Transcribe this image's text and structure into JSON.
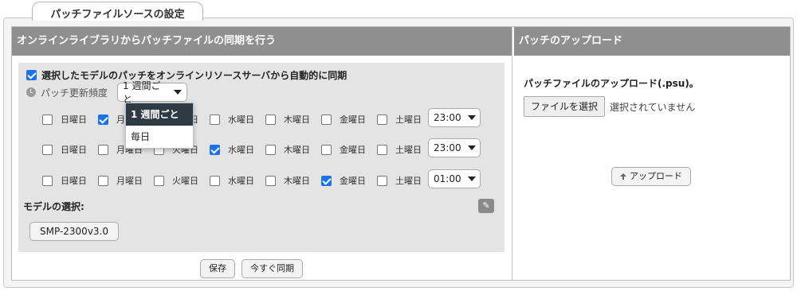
{
  "tab": {
    "label": "パッチファイルソースの設定"
  },
  "left": {
    "header": "オンラインライブラリからパッチファイルの同期を行う",
    "sync_checkbox_label": "選択したモデルのパッチをオンラインリソースサーバから自動的に同期",
    "frequency_label": "パッチ更新頻度",
    "frequency_value": "1 週間ごと",
    "frequency_options": [
      "1 週間ごと",
      "毎日"
    ],
    "days": [
      "日曜日",
      "月曜日",
      "火曜日",
      "水曜日",
      "木曜日",
      "金曜日",
      "土曜日"
    ],
    "schedules": [
      {
        "checked": [
          false,
          true,
          false,
          false,
          false,
          false,
          false
        ],
        "time": "23:00"
      },
      {
        "checked": [
          false,
          false,
          false,
          true,
          false,
          false,
          false
        ],
        "time": "23:00"
      },
      {
        "checked": [
          false,
          false,
          false,
          false,
          false,
          true,
          false
        ],
        "time": "01:00"
      }
    ],
    "model_label": "モデルの選択:",
    "model_value": "SMP-2300v3.0",
    "save_label": "保存",
    "sync_now_label": "今すぐ同期"
  },
  "right": {
    "header": "パッチのアップロード",
    "upload_title": "パッチファイルのアップロード(.psu)。",
    "file_button": "ファイルを選択",
    "file_status": "選択されていません",
    "upload_button": "アップロード"
  }
}
